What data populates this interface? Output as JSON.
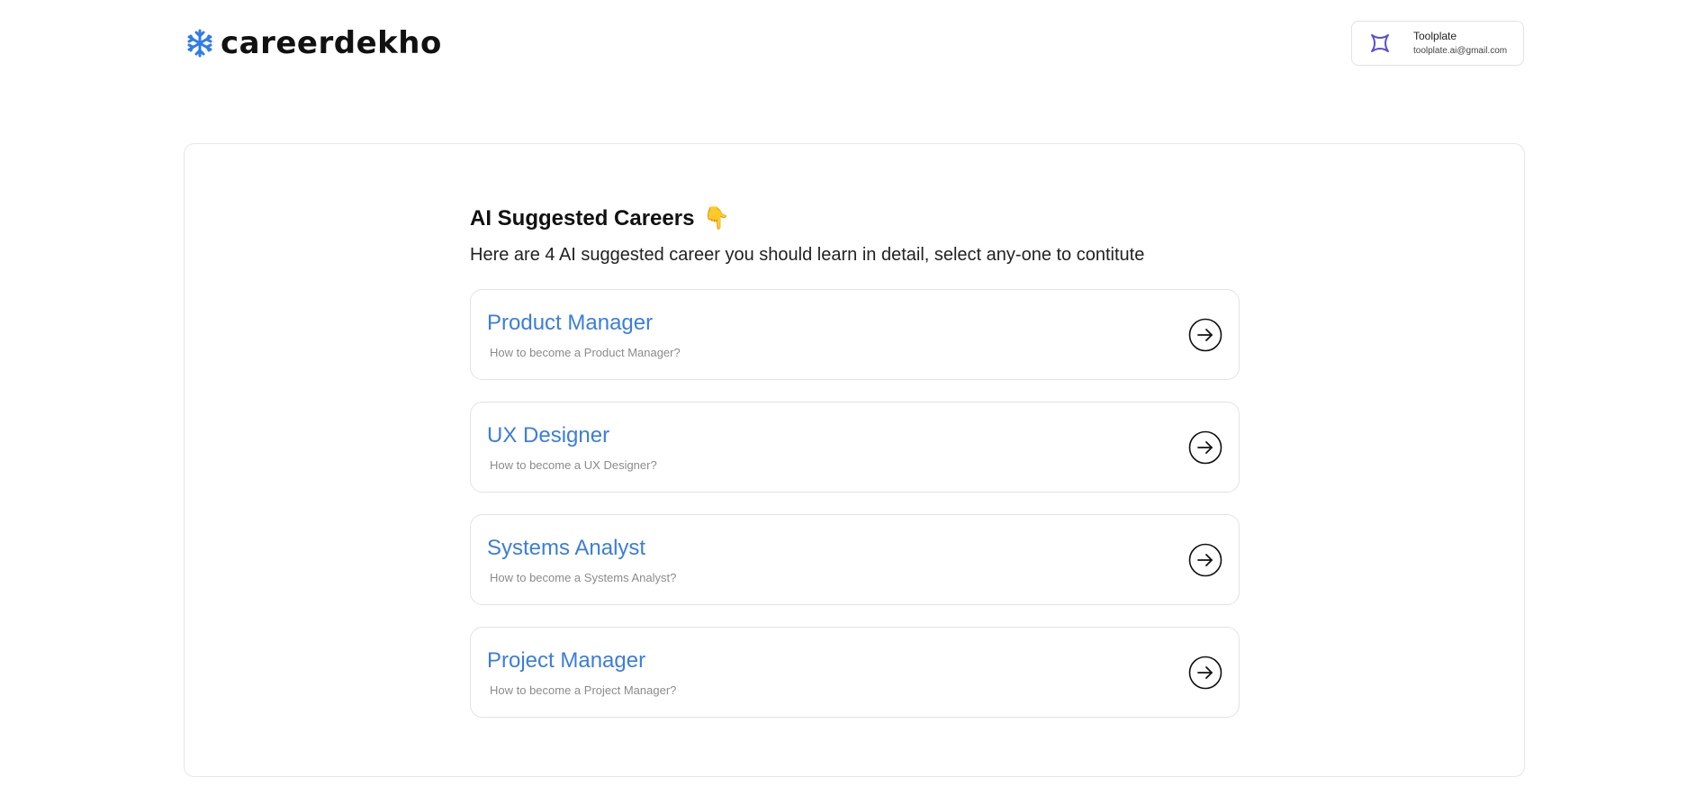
{
  "header": {
    "logo_text": "careerdekho",
    "user": {
      "name": "Toolplate",
      "email": "toolplate.ai@gmail.com"
    }
  },
  "main": {
    "title": "AI Suggested Careers",
    "title_emoji": "👇",
    "subtitle": "Here are 4 AI suggested career you should learn in detail, select any-one to contitute",
    "careers": [
      {
        "title": "Product Manager",
        "subtitle": "How to become a Product Manager?"
      },
      {
        "title": "UX Designer",
        "subtitle": "How to become a UX Designer?"
      },
      {
        "title": "Systems Analyst",
        "subtitle": "How to become a Systems Analyst?"
      },
      {
        "title": "Project Manager",
        "subtitle": "How to become a Project Manager?"
      }
    ]
  },
  "colors": {
    "brand_blue": "#3b7ddd",
    "logo_blue": "#2f7be8",
    "user_icon_purple": "#5b4ed6"
  },
  "icons": {
    "logo": "snowflake-icon",
    "user": "sparkle-icon",
    "career_action": "arrow-right-circle-icon"
  }
}
